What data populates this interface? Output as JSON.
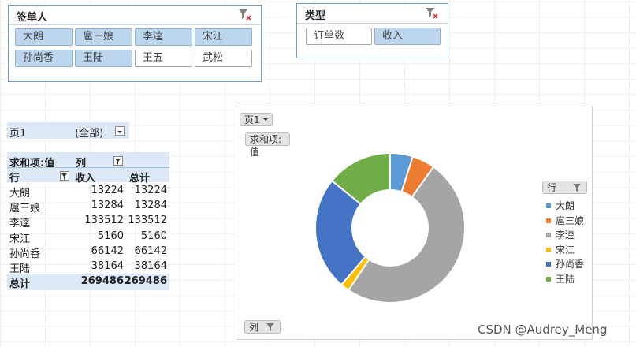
{
  "slicer_signer": {
    "title": "签单人",
    "items": [
      {
        "label": "大朗",
        "selected": true
      },
      {
        "label": "扈三娘",
        "selected": true
      },
      {
        "label": "李逵",
        "selected": true
      },
      {
        "label": "宋江",
        "selected": true
      },
      {
        "label": "孙尚香",
        "selected": true
      },
      {
        "label": "王陆",
        "selected": true
      },
      {
        "label": "王五",
        "selected": false
      },
      {
        "label": "武松",
        "selected": false
      }
    ]
  },
  "slicer_type": {
    "title": "类型",
    "items": [
      {
        "label": "订单数",
        "selected": false
      },
      {
        "label": "收入",
        "selected": true
      }
    ]
  },
  "pivot": {
    "page_field": "页1",
    "page_value": "(全部)",
    "sum_label": "求和项:值",
    "col_label": "列",
    "row_label": "行",
    "col_headers": [
      "收入",
      "总计"
    ],
    "rows": [
      {
        "name": "大朗",
        "income": "13224",
        "total": "13224"
      },
      {
        "name": "扈三娘",
        "income": "13284",
        "total": "13284"
      },
      {
        "name": "李逵",
        "income": "133512",
        "total": "133512"
      },
      {
        "name": "宋江",
        "income": "5160",
        "total": "5160"
      },
      {
        "name": "孙尚香",
        "income": "66142",
        "total": "66142"
      },
      {
        "name": "王陆",
        "income": "38164",
        "total": "38164"
      }
    ],
    "grand_total_label": "总计",
    "grand_income": "269486",
    "grand_total": "269486"
  },
  "chart_buttons": {
    "page": "页1",
    "values": "求和项:值",
    "row": "行",
    "col": "列"
  },
  "chart_data": {
    "type": "pie",
    "categories": [
      "大朗",
      "扈三娘",
      "李逵",
      "宋江",
      "孙尚香",
      "王陆"
    ],
    "values": [
      13224,
      13284,
      133512,
      5160,
      66142,
      38164
    ],
    "colors": [
      "#5b9bd5",
      "#ed7d31",
      "#a5a5a5",
      "#ffc000",
      "#4472c4",
      "#70ad47"
    ],
    "donut": true,
    "legend_position": "right"
  },
  "watermark": "CSDN @Audrey_Meng"
}
